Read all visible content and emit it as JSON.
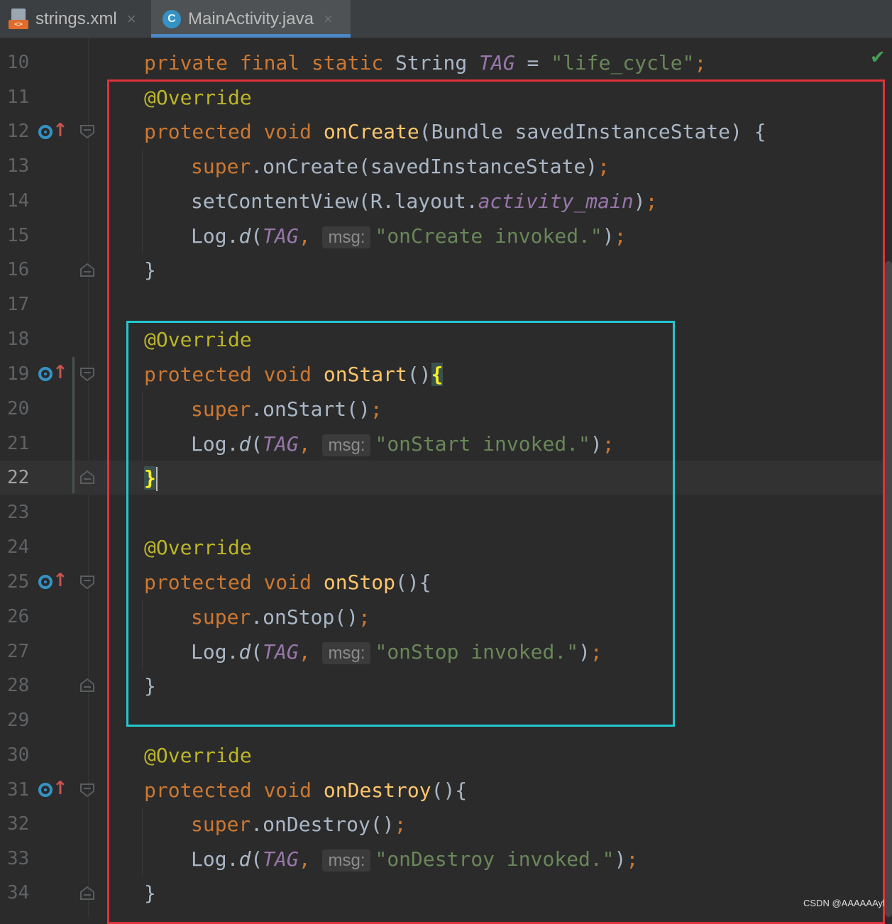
{
  "tabs": [
    {
      "label": "strings.xml",
      "icon": "xml-file-icon",
      "active": false
    },
    {
      "label": "MainActivity.java",
      "icon": "java-class-icon",
      "active": true
    }
  ],
  "icons": {
    "xml_tag": "<>",
    "class": "C",
    "close": "×",
    "check": "✔"
  },
  "editor": {
    "current_line": 22,
    "line_numbers": [
      "10",
      "11",
      "12",
      "13",
      "14",
      "15",
      "16",
      "17",
      "18",
      "19",
      "20",
      "21",
      "22",
      "23",
      "24",
      "25",
      "26",
      "27",
      "28",
      "29",
      "30",
      "31",
      "32",
      "33",
      "34"
    ],
    "tokens": {
      "private": "private",
      "final": "final",
      "static": "static",
      "String": "String",
      "TAG": "TAG",
      "eq": "=",
      "tag_value": "\"life_cycle\"",
      "semi": ";",
      "override": "@Override",
      "protected": "protected",
      "void": "void",
      "onCreate": "onCreate",
      "onStart": "onStart",
      "onStop": "onStop",
      "onDestroy": "onDestroy",
      "bundle_param": "(Bundle savedInstanceState) {",
      "open_brace": "{",
      "close_brace": "}",
      "parens_brace": "(){",
      "parens": "()",
      "super": "super",
      "super_onCreate": ".onCreate(savedInstanceState)",
      "super_onStart": ".onStart()",
      "super_onStop": ".onStop()",
      "super_onDestroy": ".onDestroy()",
      "setContentView": "setContentView(R.layout.",
      "activity_main": "activity_main",
      "close_paren": ")",
      "log": "Log.",
      "d": "d",
      "open_paren": "(",
      "comma": ",",
      "msg_hint": "msg:",
      "str_onCreate": "\"onCreate invoked.\"",
      "str_onStart": "\"onStart invoked.\"",
      "str_onStop": "\"onStop invoked.\"",
      "str_onDestroy": "\"onDestroy invoked.\""
    }
  },
  "watermark": "CSDN @AAAAAAyl",
  "colors": {
    "background": "#2b2b2b",
    "keyword": "#cc7832",
    "annotation": "#bbb529",
    "string": "#6a8759",
    "method": "#ffc66d",
    "field": "#9876aa",
    "highlight_red": "#e0323c",
    "highlight_cyan": "#22c7cf"
  }
}
